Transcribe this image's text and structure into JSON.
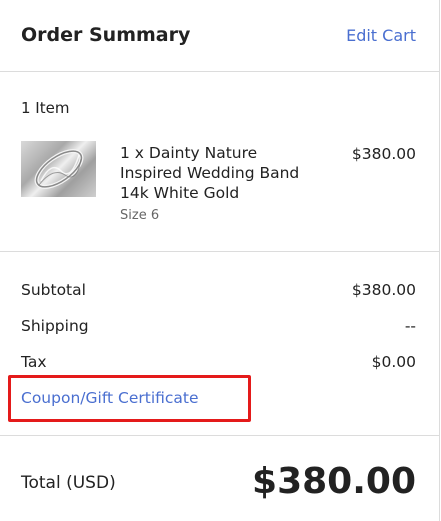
{
  "header": {
    "title": "Order Summary",
    "edit_cart": "Edit Cart"
  },
  "items": {
    "count_label": "1 Item",
    "list": [
      {
        "name": "1 x Dainty Nature Inspired Wedding Band 14k White Gold",
        "size": "Size 6",
        "price": "$380.00"
      }
    ]
  },
  "totals": {
    "subtotal_label": "Subtotal",
    "subtotal_value": "$380.00",
    "shipping_label": "Shipping",
    "shipping_value": "--",
    "tax_label": "Tax",
    "tax_value": "$0.00",
    "coupon_label": "Coupon/Gift Certificate",
    "highlight_color": "#e41a1a"
  },
  "grand_total": {
    "label": "Total (USD)",
    "value": "$380.00"
  },
  "colors": {
    "link": "#4a6fd0",
    "text": "#222222",
    "divider": "#dcdcdc"
  }
}
